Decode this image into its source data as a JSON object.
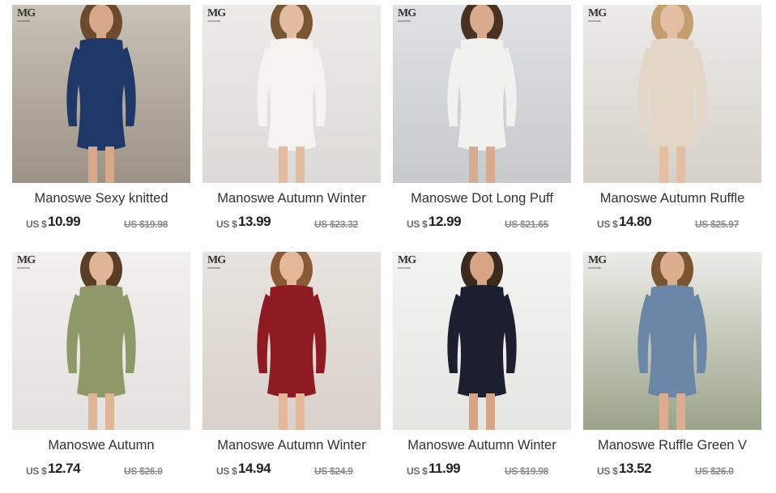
{
  "brand_logo": {
    "mark": "MG",
    "sub": "MANOSWE"
  },
  "products": [
    {
      "title": "Manoswe Sexy knitted",
      "currency": "US $",
      "price": "10.99",
      "original": "US $19.98",
      "image": "navy-bodycon-dress-photo",
      "colors": {
        "bg1": "#c9c2b8",
        "bg2": "#9d9286",
        "dress": "#1f3868",
        "skin": "#d7a88a",
        "hair": "#6b4a2e"
      }
    },
    {
      "title": "Manoswe Autumn Winter",
      "currency": "US $",
      "price": "13.99",
      "original": "US $23.32",
      "image": "white-sweater-dress-photo",
      "colors": {
        "bg1": "#ecebe8",
        "bg2": "#dcdad5",
        "dress": "#f4f3ef",
        "skin": "#e2bba0",
        "hair": "#7a5532"
      }
    },
    {
      "title": "Manoswe Dot Long Puff",
      "currency": "US $",
      "price": "12.99",
      "original": "US $21.65",
      "image": "white-mesh-sleeve-dress-photo",
      "colors": {
        "bg1": "#dfe1e4",
        "bg2": "#c7cacd",
        "dress": "#f1f1ef",
        "skin": "#d9ab8e",
        "hair": "#4a3222"
      }
    },
    {
      "title": "Manoswe Autumn Ruffle",
      "currency": "US $",
      "price": "14.80",
      "original": "US $25.97",
      "image": "beige-ruffle-dress-photo",
      "colors": {
        "bg1": "#ecebe9",
        "bg2": "#d6d0c8",
        "dress": "#e4d6c7",
        "skin": "#e4bea2",
        "hair": "#c59e70"
      }
    },
    {
      "title": "Manoswe Autumn",
      "currency": "US $",
      "price": "12.74",
      "original": "US $26.0",
      "image": "olive-wrap-dress-photo",
      "colors": {
        "bg1": "#f1f0ee",
        "bg2": "#e3e1de",
        "dress": "#8f9868",
        "skin": "#e0b596",
        "hair": "#5b3d26"
      }
    },
    {
      "title": "Manoswe Autumn Winter",
      "currency": "US $",
      "price": "14.94",
      "original": "US $24.9",
      "image": "red-cable-knit-dress-photo",
      "colors": {
        "bg1": "#e8e3de",
        "bg2": "#d9d1ca",
        "dress": "#8e1a24",
        "skin": "#e4b898",
        "hair": "#8a5a36"
      }
    },
    {
      "title": "Manoswe Autumn Winter",
      "currency": "US $",
      "price": "11.99",
      "original": "US $19.98",
      "image": "black-bodycon-dress-photo",
      "colors": {
        "bg1": "#f3f3f1",
        "bg2": "#e5e5e2",
        "dress": "#1c1f30",
        "skin": "#d7a486",
        "hair": "#3c2a1f"
      }
    },
    {
      "title": "Manoswe Ruffle Green V",
      "currency": "US $",
      "price": "13.52",
      "original": "US $26.0",
      "image": "blue-v-neck-dress-photo",
      "colors": {
        "bg1": "#ecebe8",
        "bg2": "#9aa489",
        "dress": "#6c86a8",
        "skin": "#dcae8f",
        "hair": "#7b5431"
      }
    }
  ]
}
